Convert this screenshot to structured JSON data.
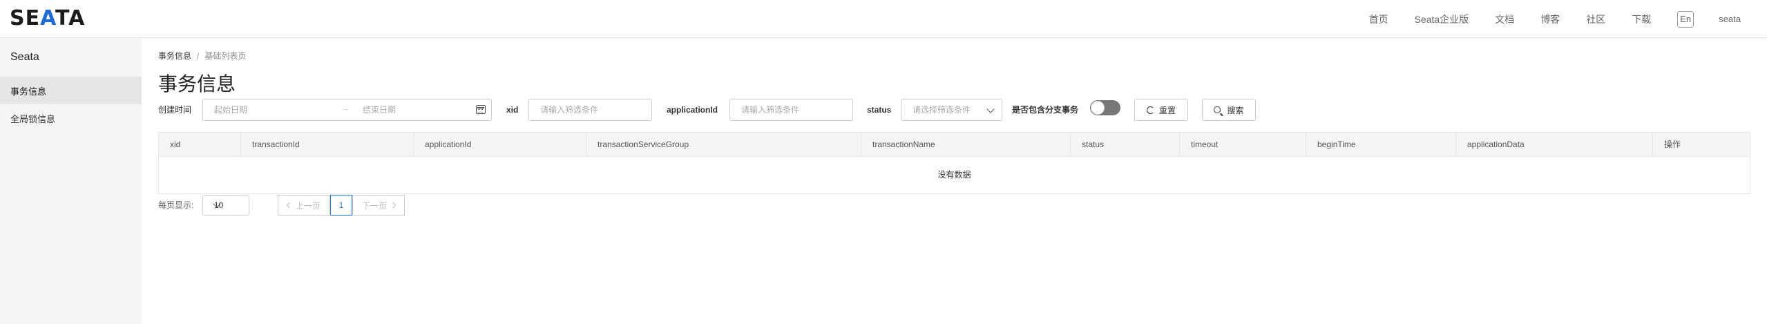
{
  "header": {
    "logo": "SEATA",
    "nav": [
      "首页",
      "Seata企业版",
      "文档",
      "博客",
      "社区",
      "下载"
    ],
    "lang": "En",
    "user": "seata"
  },
  "sidebar": {
    "title": "Seata",
    "items": [
      {
        "label": "事务信息",
        "active": true
      },
      {
        "label": "全局锁信息",
        "active": false
      }
    ]
  },
  "main": {
    "breadcrumb": [
      "事务信息",
      "基础列表页"
    ],
    "title": "事务信息",
    "filters": {
      "created_label": "创建时间",
      "start_placeholder": "起始日期",
      "range_sep": "~",
      "end_placeholder": "结束日期",
      "xid_label": "xid",
      "xid_placeholder": "请输入筛选条件",
      "appid_label": "applicationId",
      "appid_placeholder": "请输入筛选条件",
      "status_label": "status",
      "status_placeholder": "请选择筛选条件",
      "branch_label": "是否包含分支事务",
      "branch_on": false,
      "reset_label": "重置",
      "search_label": "搜索"
    },
    "table": {
      "columns": [
        "xid",
        "transactionId",
        "applicationId",
        "transactionServiceGroup",
        "transactionName",
        "status",
        "timeout",
        "beginTime",
        "applicationData",
        "操作"
      ],
      "empty_text": "没有数据"
    },
    "pagination": {
      "per_page_label": "每页显示:",
      "page_size": "10",
      "prev_label": "上一页",
      "next_label": "下一页",
      "current_page": "1"
    }
  },
  "colors": {
    "accent": "#2878d0",
    "logo_accent": "#1f6bd6",
    "sidebar_bg": "#f5f5f5",
    "toggle_off": "#777777"
  }
}
